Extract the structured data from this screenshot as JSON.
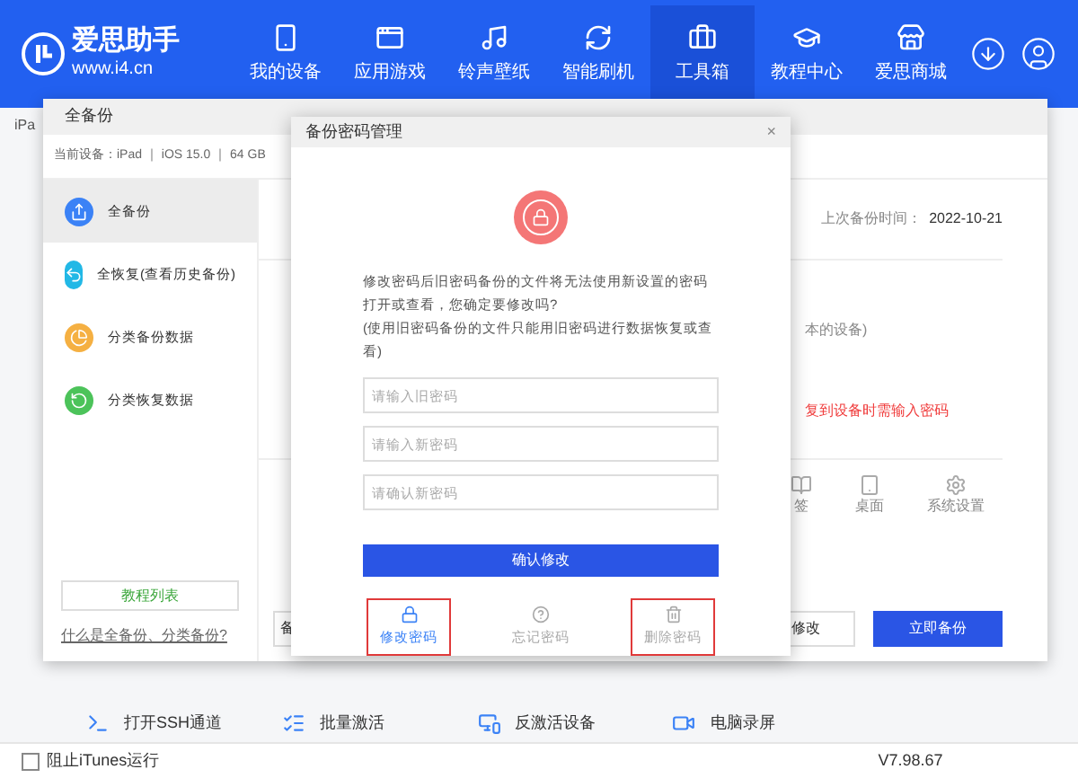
{
  "app": {
    "logo_name": "爱思助手",
    "logo_url": "www.i4.cn"
  },
  "nav": [
    {
      "label": "我的设备",
      "selected": false
    },
    {
      "label": "应用游戏",
      "selected": false
    },
    {
      "label": "铃声壁纸",
      "selected": false
    },
    {
      "label": "智能刷机",
      "selected": false
    },
    {
      "label": "工具箱",
      "selected": true
    },
    {
      "label": "教程中心",
      "selected": false
    },
    {
      "label": "爱思商城",
      "selected": false
    }
  ],
  "page": {
    "device_tab": "iPa",
    "tools": [
      {
        "label": "打开SSH通道"
      },
      {
        "label": "批量激活"
      },
      {
        "label": "反激活设备"
      },
      {
        "label": "电脑录屏"
      }
    ]
  },
  "backup_window": {
    "title": "全备份",
    "device_info": "当前设备：iPad ｜ iOS 15.0 ｜ 64 GB",
    "menu": [
      {
        "label": "全备份",
        "selected": true,
        "color": "#3b82f6"
      },
      {
        "label": "全恢复(查看历史备份)",
        "selected": false,
        "color": "#22b8e6"
      },
      {
        "label": "分类备份数据",
        "selected": false,
        "color": "#f5b042"
      },
      {
        "label": "分类恢复数据",
        "selected": false,
        "color": "#4cc35a"
      }
    ],
    "tutorial_button": "教程列表",
    "help_link": "什么是全备份、分类备份?",
    "last_backup_label": "上次备份时间：",
    "last_backup_value": "2022-10-21",
    "note_partial": "本的设备)",
    "warning_partial": "复到设备时需输入密码",
    "data_items": [
      {
        "label": "签"
      },
      {
        "label": "桌面"
      },
      {
        "label": "系统设置"
      }
    ],
    "left_button_partial": "备",
    "modify_button": "修改",
    "backup_button": "立即备份"
  },
  "password_dialog": {
    "title": "备份密码管理",
    "close": "×",
    "message": "修改密码后旧密码备份的文件将无法使用新设置的密码打开或查看，您确定要修改吗?",
    "hint": "(使用旧密码备份的文件只能用旧密码进行数据恢复或查看)",
    "fields": [
      {
        "placeholder": "请输入旧密码"
      },
      {
        "placeholder": "请输入新密码"
      },
      {
        "placeholder": "请确认新密码"
      }
    ],
    "confirm_button": "确认修改",
    "actions": [
      {
        "label": "修改密码",
        "kind": "lock",
        "selected": true,
        "highlighted": true
      },
      {
        "label": "忘记密码",
        "kind": "help",
        "selected": false,
        "highlighted": false
      },
      {
        "label": "删除密码",
        "kind": "trash",
        "selected": false,
        "highlighted": true
      }
    ]
  },
  "status_bar": {
    "block_itunes": {
      "label": "阻止iTunes运行",
      "checked": false
    },
    "version": "V7.98.67"
  }
}
